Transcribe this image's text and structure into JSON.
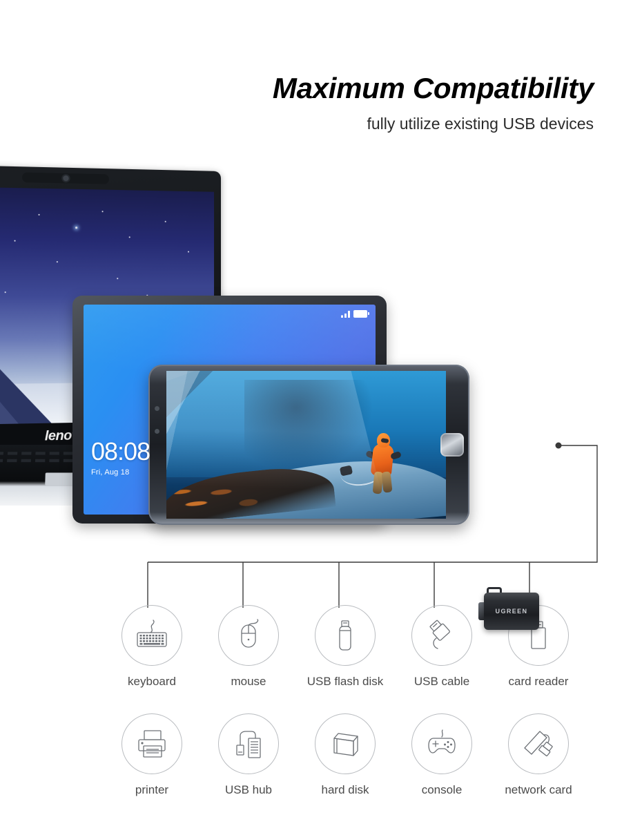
{
  "header": {
    "headline": "Maximum Compatibility",
    "subheadline": "fully utilize existing USB devices"
  },
  "devices": {
    "laptop_brand": "lenovo",
    "tablet_clock_time": "08:08",
    "tablet_clock_date": "Fri, Aug 18",
    "adapter_brand": "UGREEN"
  },
  "compatibility": {
    "row1": [
      {
        "label": "keyboard",
        "icon": "keyboard-icon"
      },
      {
        "label": "mouse",
        "icon": "mouse-icon"
      },
      {
        "label": "USB flash disk",
        "icon": "usb-flash-disk-icon"
      },
      {
        "label": "USB cable",
        "icon": "usb-cable-icon"
      },
      {
        "label": "card reader",
        "icon": "card-reader-icon"
      }
    ],
    "row2": [
      {
        "label": "printer",
        "icon": "printer-icon"
      },
      {
        "label": "USB hub",
        "icon": "usb-hub-icon"
      },
      {
        "label": "hard disk",
        "icon": "hard-disk-icon"
      },
      {
        "label": "console",
        "icon": "console-icon"
      },
      {
        "label": "network card",
        "icon": "network-card-icon"
      }
    ]
  },
  "colors": {
    "background": "#ffffff",
    "headline": "#000000",
    "subheadline": "#2b2b2b",
    "icon_outline": "#b9bcc0",
    "icon_label": "#4b4b4b",
    "leader_line": "#3a3a3a"
  }
}
